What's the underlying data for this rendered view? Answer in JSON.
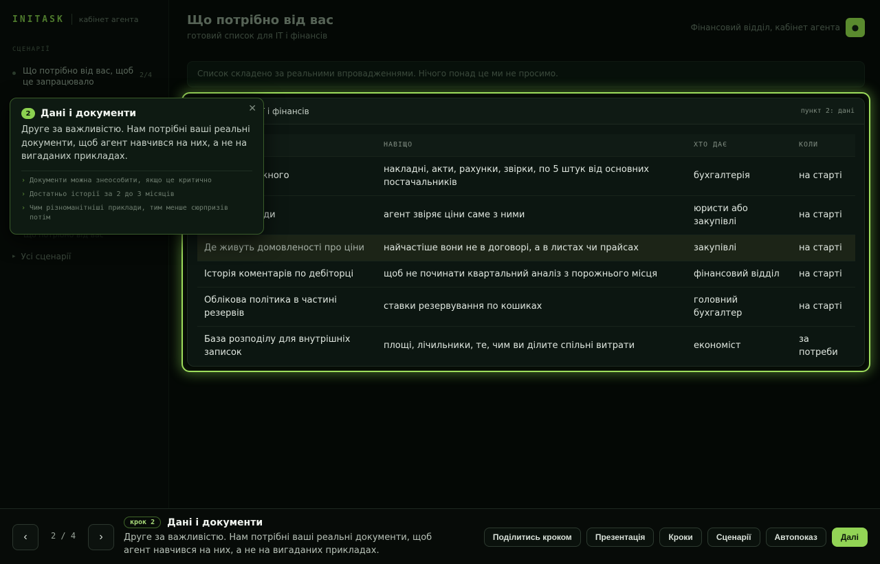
{
  "brand": {
    "name": "INITASK",
    "subtitle": "кабінет агента"
  },
  "sidebar": {
    "section_label": "СЦЕНАРІЇ",
    "items": [
      {
        "label": "Що потрібно від вас, щоб це запрацювало",
        "count": "2/4"
      }
    ],
    "ghost_label": "Що потрібно від вас",
    "all_label": "Усі сценарії",
    "all_icon": "chevron-right-icon"
  },
  "header": {
    "title": "Що потрібно від вас",
    "subtitle": "готовий список для IT і фінансів",
    "context": "Фінансовий відділ, кабінет агента",
    "avatar_icon": "dot-icon"
  },
  "notice": "Список складено за реальними впровадженнями. Нічого понад це ми не просимо.",
  "card": {
    "title": "для вашого IT і фінансів",
    "ref": "пункт 2: дані",
    "columns": [
      "",
      "НАВІЩО",
      "ХТО ДАЄ",
      "КОЛИ"
    ],
    "rows": [
      {
        "name": "кументів кожного",
        "why": "накладні, акти, рахунки, звірки, по 5 штук від основних постачальників",
        "who": "бухгалтерія",
        "when": "на старті"
      },
      {
        "name": "одаткові угоди",
        "why": "агент звіряє ціни саме з ними",
        "who": "юристи або закупівлі",
        "when": "на старті"
      },
      {
        "name": "Де живуть домовленості про ціни",
        "why": "найчастіше вони не в договорі, а в листах чи прайсах",
        "who": "закупівлі",
        "when": "на старті"
      },
      {
        "name": "Історія коментарів по дебіторці",
        "why": "щоб не починати квартальний аналіз з порожнього місця",
        "who": "фінансовий відділ",
        "when": "на старті"
      },
      {
        "name": "Облікова політика в частині резервів",
        "why": "ставки резервування по кошиках",
        "who": "головний бухгалтер",
        "when": "на старті"
      },
      {
        "name": "База розподілу для внутрішніх записок",
        "why": "площі, лічильники, те, чим ви ділите спільні витрати",
        "who": "економіст",
        "when": "за потреби"
      }
    ]
  },
  "tooltip": {
    "number": "2",
    "title": "Дані і документи",
    "body": "Друге за важливістю. Нам потрібні ваші реальні документи, щоб агент навчився на них, а не на вигаданих прикладах.",
    "tips": [
      "Документи можна знеособити, якщо це критично",
      "Достатньо історії за 2 до 3 місяців",
      "Чим різноманітніші приклади, тим менше сюрпризів потім"
    ],
    "close_glyph": "✕"
  },
  "bottom": {
    "prev_glyph": "‹",
    "next_glyph": "›",
    "counter": "2 / 4",
    "step_badge": "крок 2",
    "step_title": "Дані і документи",
    "step_desc": "Друге за важливістю. Нам потрібні ваші реальні документи, щоб агент навчився на них, а не на вигаданих прикладах.",
    "actions": [
      "Поділитись кроком",
      "Презентація",
      "Кроки",
      "Сценарії",
      "Автопоказ",
      "Далі"
    ]
  },
  "colors": {
    "accent": "#92d455",
    "highlight_border": "#9ede5c",
    "background": "#040805"
  }
}
